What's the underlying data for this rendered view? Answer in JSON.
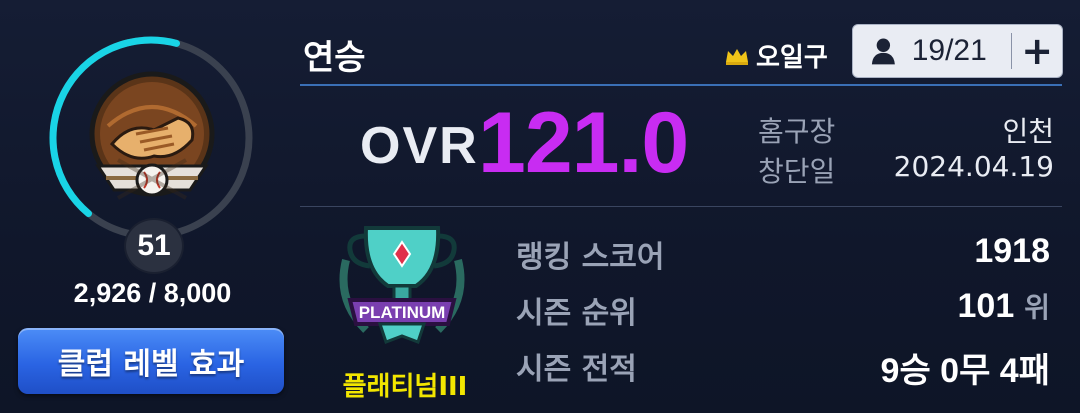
{
  "club": {
    "title": "연승",
    "level": "51",
    "xp_text": "2,926 / 8,000",
    "xp_progress": 0.366,
    "level_effect_button": "클럽 레벨 효과"
  },
  "owner": {
    "name": "오일구",
    "icon": "crown-icon"
  },
  "members": {
    "count_text": "19/21",
    "icon": "person-icon",
    "add_icon": "plus-icon",
    "add_label": "+"
  },
  "ovr": {
    "label": "OVR",
    "value": "121.0"
  },
  "info": {
    "home_label": "홈구장",
    "home_value": "인천",
    "founded_label": "창단일",
    "founded_value": "2024.04.19"
  },
  "tier": {
    "name": "플래티넘III",
    "emblem_text": "PLATINUM"
  },
  "stats": {
    "ranking_label": "랭킹 스코어",
    "ranking_value": "1918",
    "rank_label": "시즌 순위",
    "rank_value": "101",
    "rank_unit": "위",
    "record_label": "시즌 전적",
    "record_value": "9승 0무 4패"
  },
  "colors": {
    "background": "#121a2f",
    "ovr_value": "#c82cf2",
    "progress_ring": "#19d4e6",
    "tier_name": "#f2e600",
    "button_blue": "#2a64e3"
  }
}
